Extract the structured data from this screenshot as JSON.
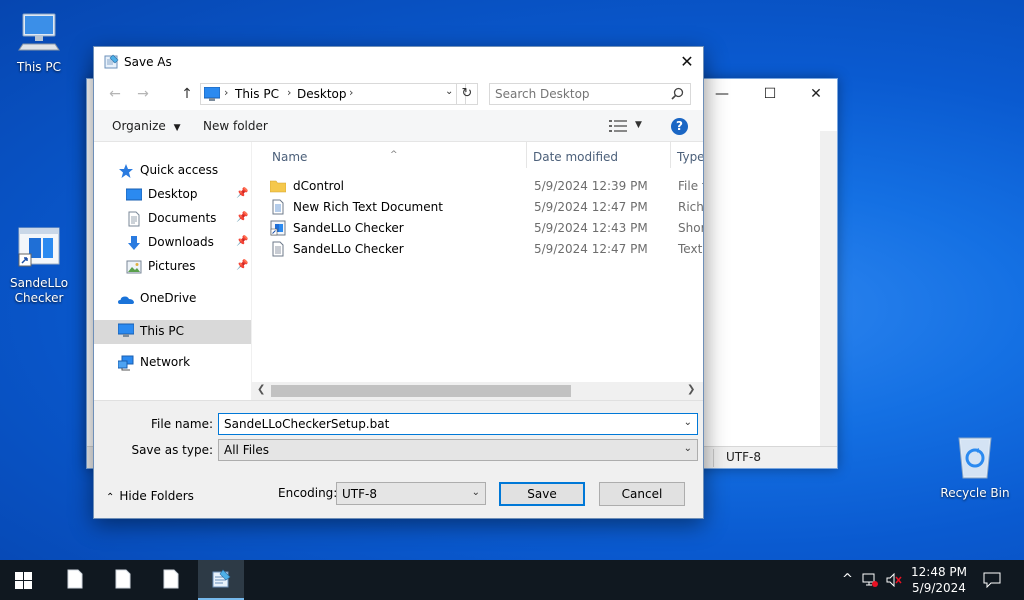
{
  "desktop": {
    "icons": [
      {
        "label": "This PC",
        "icon": "this-pc-icon"
      },
      {
        "label": "SandeLLo Checker",
        "icon": "shortcut-icon"
      },
      {
        "label": "Recycle Bin",
        "icon": "recycle-bin-icon"
      }
    ]
  },
  "background_window": {
    "encoding": "UTF-8",
    "controls": {
      "minimize": "—",
      "maximize": "☐",
      "close": "✕"
    }
  },
  "dialog": {
    "title": "Save As",
    "close_glyph": "✕",
    "address": {
      "crumbs": [
        "This PC",
        "Desktop"
      ]
    },
    "search": {
      "placeholder": "Search Desktop"
    },
    "toolbar": {
      "organize": "Organize",
      "new_folder": "New folder",
      "help": "?"
    },
    "nav": {
      "items": [
        {
          "label": "Quick access",
          "icon": "star-icon"
        },
        {
          "label": "Desktop",
          "icon": "desktop-folder-icon",
          "pinned": true
        },
        {
          "label": "Documents",
          "icon": "documents-icon",
          "pinned": true
        },
        {
          "label": "Downloads",
          "icon": "downloads-icon",
          "pinned": true
        },
        {
          "label": "Pictures",
          "icon": "pictures-icon",
          "pinned": true
        },
        {
          "label": "OneDrive",
          "icon": "onedrive-icon"
        },
        {
          "label": "This PC",
          "icon": "this-pc-icon",
          "selected": true
        },
        {
          "label": "Network",
          "icon": "network-icon"
        }
      ]
    },
    "columns": {
      "name": "Name",
      "date": "Date modified",
      "type": "Type"
    },
    "files": [
      {
        "name": "dControl",
        "date": "5/9/2024 12:39 PM",
        "type": "File fo",
        "icon": "folder-icon"
      },
      {
        "name": "New Rich Text Document",
        "date": "5/9/2024 12:47 PM",
        "type": "Rich T",
        "icon": "rtf-document-icon"
      },
      {
        "name": "SandeLLo Checker",
        "date": "5/9/2024 12:43 PM",
        "type": "Short",
        "icon": "shortcut-file-icon"
      },
      {
        "name": "SandeLLo Checker",
        "date": "5/9/2024 12:47 PM",
        "type": "Text D",
        "icon": "text-document-icon"
      }
    ],
    "form": {
      "file_name_label": "File name:",
      "file_name_value": "SandeLLoCheckerSetup.bat",
      "save_type_label": "Save as type:",
      "save_type_value": "All Files",
      "hide_folders": "Hide Folders",
      "encoding_label": "Encoding:",
      "encoding_value": "UTF-8",
      "save": "Save",
      "cancel": "Cancel"
    }
  },
  "taskbar": {
    "clock_time": "12:48 PM",
    "clock_date": "5/9/2024",
    "tray_chevron": "^"
  }
}
